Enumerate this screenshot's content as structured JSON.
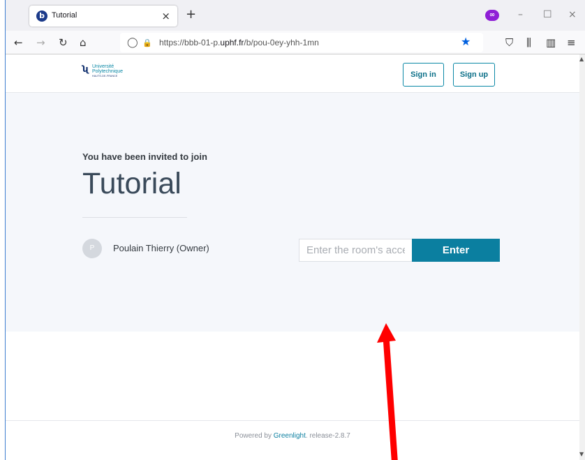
{
  "browser": {
    "tab_title": "Tutorial",
    "tab_favicon": "b",
    "url_prefix": "https://bbb-01-p.",
    "url_domain": "uphf.fr",
    "url_path": "/b/pou-0ey-yhh-1mn",
    "window_buttons": {
      "minimize": "–",
      "maximize": "☐",
      "close": "×"
    },
    "icons": {
      "back": "←",
      "forward": "→",
      "reload": "↻",
      "home": "⌂",
      "shield": "◯",
      "lock": "🔒",
      "star": "★",
      "pocket": "⛉",
      "library": "⫼",
      "sidebar": "▥",
      "menu": "≡",
      "new_tab": "+",
      "tab_close": "×",
      "private": "∞"
    }
  },
  "site": {
    "logo": {
      "line1": "Université",
      "line2": "Polytechnique",
      "line3": "HAUTS-DE-FRANCE"
    },
    "sign_in_label": "Sign in",
    "sign_up_label": "Sign up"
  },
  "room": {
    "invite_text": "You have been invited to join",
    "name": "Tutorial",
    "owner_initial": "P",
    "owner_name": "Poulain Thierry (Owner)",
    "access_code_placeholder": "Enter the room's access code",
    "enter_label": "Enter"
  },
  "footer": {
    "powered_by": "Powered by ",
    "link": "Greenlight",
    "release": ". release-2.8.7"
  },
  "colors": {
    "accent": "#0b7fa0",
    "annotation_arrow": "#ff0000"
  }
}
